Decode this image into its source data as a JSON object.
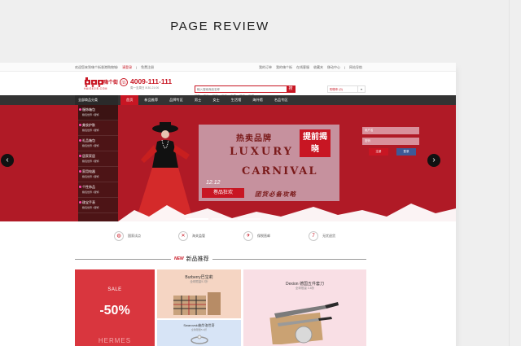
{
  "review_title": "PAGE REVIEW",
  "topbar": {
    "left": [
      "欢迎您来到嗨个街香港购物城!",
      "请登录",
      "|",
      "免费注册"
    ],
    "right": [
      "我的订单",
      "我的嗨个街",
      "在线客服",
      "收藏夹",
      "移动中心",
      "|",
      "网站导航"
    ]
  },
  "logo": {
    "text": "嗨个街",
    "sub": "HAIGEJIE.COM"
  },
  "hotline": {
    "number": "4009-111-111",
    "sub": "周一至周日 8:30-21:00"
  },
  "search": {
    "placeholder": "输入搜索商品名称",
    "button": "搜",
    "keywords": [
      "护肤",
      "彩妆",
      "奶粉",
      "包包",
      "手表",
      "洋酒",
      "保健"
    ]
  },
  "cart": {
    "label": "购物车 (0)",
    "arrow": "▾"
  },
  "nav": {
    "category_label": "全部商品分类",
    "items": [
      "首页",
      "新品推荐",
      "品牌专区",
      "男士",
      "女士",
      "生活馆",
      "海外馆",
      "名品专区"
    ],
    "active_index": 0
  },
  "categories": [
    {
      "title": "服饰箱包",
      "sub": "箱包世界 / 服饰"
    },
    {
      "title": "美妆护肤",
      "sub": "箱包世界 / 服饰"
    },
    {
      "title": "礼品箱包",
      "sub": "箱包世界 / 服饰"
    },
    {
      "title": "居家家居",
      "sub": "箱包世界 / 服饰"
    },
    {
      "title": "家用电器",
      "sub": "箱包世界 / 服饰"
    },
    {
      "title": "个性饰品",
      "sub": "箱包世界 / 服饰"
    },
    {
      "title": "珠宝手表",
      "sub": "箱包世界 / 服饰"
    }
  ],
  "banner": {
    "line1": "热卖品牌",
    "badge": "提前揭晓",
    "line2": "LUXURY",
    "line3": "CARNIVAL",
    "date": "12.12",
    "tag": "巻品狂欢",
    "slogan": "团货必备攻略"
  },
  "login": {
    "user_placeholder": "用户名",
    "pass_placeholder": "密码",
    "register": "注册",
    "login": "登录"
  },
  "features": [
    "国家试点",
    "海关监管",
    "保税直邮",
    "无忧退货"
  ],
  "section": {
    "new_tag": "NEW",
    "title": "新品推荐"
  },
  "goods": {
    "sale": "SALE",
    "discount": "-50%",
    "brand": "HERMES",
    "burberry_name": "Burberry巴宝莉",
    "burberry_sub": "全球限量5.2折",
    "swarovski_name": "Swarovski施华洛世奇",
    "swarovski_sub": "全球限量5.2折",
    "dexion_name": "Dexion 德国五件套刀",
    "dexion_sub": "全球限量 3.8折"
  },
  "colors": {
    "brand_red": "#c81623",
    "nav_dark": "#333333",
    "banner_red": "#b01a26"
  }
}
